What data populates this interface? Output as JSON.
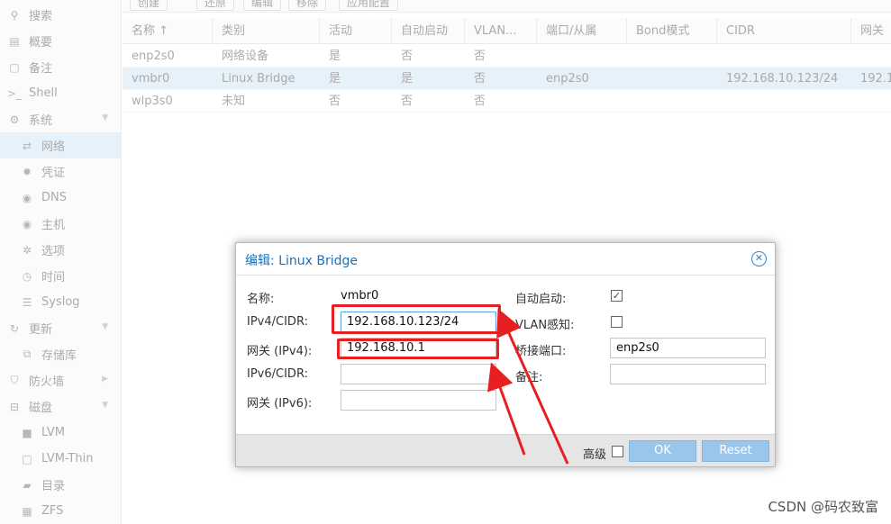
{
  "toolbar": {
    "create": "创建",
    "revert": "还原",
    "edit": "编辑",
    "remove": "移除",
    "apply": "应用配置"
  },
  "sidebar": {
    "items": [
      {
        "label": "搜索",
        "icon": "search-icon",
        "glyph": "⚲"
      },
      {
        "label": "概要",
        "icon": "book-icon",
        "glyph": "▤"
      },
      {
        "label": "备注",
        "icon": "note-icon",
        "glyph": "▢"
      },
      {
        "label": "Shell",
        "icon": "terminal-icon",
        "glyph": ">_"
      },
      {
        "label": "系统",
        "icon": "cogs-icon",
        "glyph": "⚙"
      },
      {
        "label": "网络",
        "icon": "exchange-icon",
        "glyph": "⇄"
      },
      {
        "label": "凭证",
        "icon": "certificate-icon",
        "glyph": "✹"
      },
      {
        "label": "DNS",
        "icon": "globe-icon",
        "glyph": "◉"
      },
      {
        "label": "主机",
        "icon": "globe-icon",
        "glyph": "◉"
      },
      {
        "label": "选项",
        "icon": "gear-icon",
        "glyph": "✲"
      },
      {
        "label": "时间",
        "icon": "clock-icon",
        "glyph": "◷"
      },
      {
        "label": "Syslog",
        "icon": "list-icon",
        "glyph": "☰"
      },
      {
        "label": "更新",
        "icon": "refresh-icon",
        "glyph": "↻"
      },
      {
        "label": "存储库",
        "icon": "files-icon",
        "glyph": "⧉"
      },
      {
        "label": "防火墙",
        "icon": "shield-icon",
        "glyph": "⛉"
      },
      {
        "label": "磁盘",
        "icon": "hdd-icon",
        "glyph": "⊟"
      },
      {
        "label": "LVM",
        "icon": "square-icon",
        "glyph": "■"
      },
      {
        "label": "LVM-Thin",
        "icon": "square-outline-icon",
        "glyph": "□"
      },
      {
        "label": "目录",
        "icon": "folder-icon",
        "glyph": "▰"
      },
      {
        "label": "ZFS",
        "icon": "grid-icon",
        "glyph": "▦"
      }
    ]
  },
  "table": {
    "columns": [
      "名称 ↑",
      "类别",
      "活动",
      "自动启动",
      "VLAN...",
      "端口/从属",
      "Bond模式",
      "CIDR",
      "网关"
    ],
    "rows": [
      [
        "enp2s0",
        "网络设备",
        "是",
        "否",
        "否",
        "",
        "",
        "",
        ""
      ],
      [
        "vmbr0",
        "Linux Bridge",
        "是",
        "是",
        "否",
        "enp2s0",
        "",
        "192.168.10.123/24",
        "192.1"
      ],
      [
        "wlp3s0",
        "未知",
        "否",
        "否",
        "否",
        "",
        "",
        "",
        ""
      ]
    ]
  },
  "dialog": {
    "title": "编辑: Linux Bridge",
    "name_label": "名称:",
    "name_value": "vmbr0",
    "ipv4_label": "IPv4/CIDR:",
    "ipv4_value": "192.168.10.123/24",
    "gw4_label": "网关 (IPv4):",
    "gw4_value": "192.168.10.1",
    "ipv6_label": "IPv6/CIDR:",
    "ipv6_value": "",
    "gw6_label": "网关 (IPv6):",
    "gw6_value": "",
    "autostart_label": "自动启动:",
    "autostart_checked": true,
    "vlan_label": "VLAN感知:",
    "vlan_checked": false,
    "ports_label": "桥接端口:",
    "ports_value": "enp2s0",
    "comment_label": "备注:",
    "comment_value": "",
    "advanced_label": "高级",
    "ok_label": "OK",
    "reset_label": "Reset"
  },
  "watermark": "CSDN @码农致富",
  "colors": {
    "selection": "#c2ddf2",
    "accent": "#1d6fb4",
    "annotation": "#e62020",
    "button": "#9bc6eb"
  }
}
